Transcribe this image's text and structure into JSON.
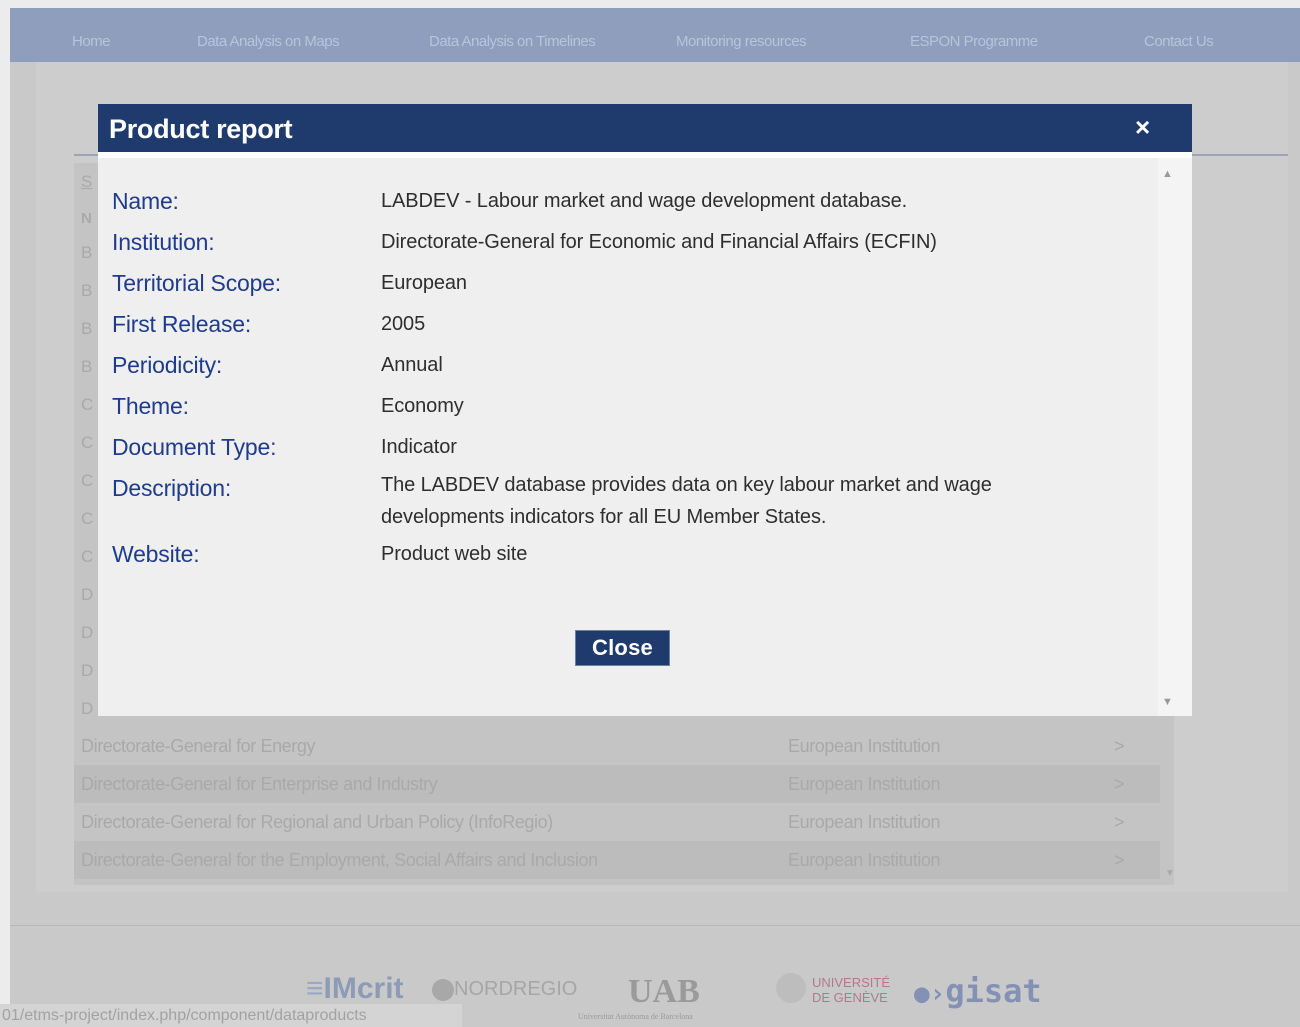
{
  "nav": {
    "items": [
      "Home",
      "Data Analysis on Maps",
      "Data Analysis on Timelines",
      "Monitoring resources",
      "ESPON Programme",
      "Contact Us"
    ]
  },
  "background_table": {
    "header_letters": [
      "S",
      "N"
    ],
    "row_letters": [
      "B",
      "B",
      "B",
      "B",
      "C",
      "C",
      "C",
      "C",
      "C",
      "D",
      "D",
      "D",
      "D"
    ],
    "rows": [
      {
        "name": "Directorate-General for Energy",
        "type": "European Institution",
        "arrow": ">"
      },
      {
        "name": "Directorate-General for Enterprise and Industry",
        "type": "European Institution",
        "arrow": ">"
      },
      {
        "name": "Directorate-General for Regional and Urban Policy (InfoRegio)",
        "type": "European Institution",
        "arrow": ">"
      },
      {
        "name": "Directorate-General for the Employment, Social Affairs and Inclusion",
        "type": "European Institution",
        "arrow": ">"
      }
    ]
  },
  "modal": {
    "title": "Product report",
    "close_icon": "×",
    "fields": [
      {
        "label": "Name:",
        "value": "LABDEV - Labour market and wage development database."
      },
      {
        "label": "Institution:",
        "value": "Directorate-General for Economic and Financial Affairs (ECFIN)"
      },
      {
        "label": "Territorial Scope:",
        "value": "European"
      },
      {
        "label": "First Release:",
        "value": "2005"
      },
      {
        "label": "Periodicity:",
        "value": "Annual"
      },
      {
        "label": "Theme:",
        "value": "Economy"
      },
      {
        "label": "Document Type:",
        "value": "Indicator"
      },
      {
        "label": "Description:",
        "value": "The LABDEV database provides data on key labour market and wage developments indicators for all EU Member States."
      },
      {
        "label": "Website:",
        "value": "Product web site"
      }
    ],
    "close_button": "Close"
  },
  "footer": {
    "logos": [
      "IMcrit",
      "NORDREGIO",
      "UAB",
      "Universitat Autònoma de Barcelona",
      "UNIVERSITÉ DE GENÈVE",
      "gisat"
    ]
  },
  "status_url": "01/etms-project/index.php/component/dataproducts",
  "colors": {
    "nav_bg": "#8f9ebd",
    "modal_header": "#1f3b6d",
    "label_blue": "#1f3b8c"
  }
}
